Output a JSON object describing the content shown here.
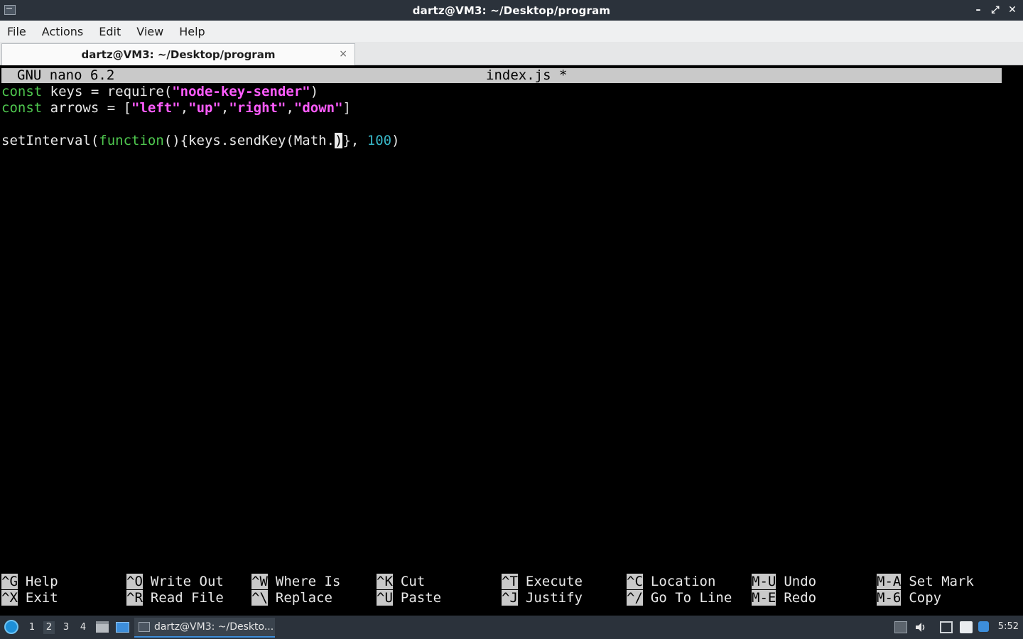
{
  "window": {
    "title": "dartz@VM3: ~/Desktop/program",
    "controls": {
      "minimize": "–",
      "maximize": "⤢",
      "close": "✕"
    }
  },
  "menu": {
    "items": [
      "File",
      "Actions",
      "Edit",
      "View",
      "Help"
    ]
  },
  "tab": {
    "label": "dartz@VM3: ~/Desktop/program",
    "close": "×"
  },
  "nano": {
    "version": "GNU nano 6.2",
    "filename": "index.js *",
    "code": {
      "line1": {
        "kw": "const",
        "rest1": " keys = require(",
        "str": "\"node-key-sender\"",
        "rest2": ")"
      },
      "line2": {
        "kw": "const",
        "rest1": " arrows = [",
        "s1": "\"left\"",
        "c1": ",",
        "s2": "\"up\"",
        "c2": ",",
        "s3": "\"right\"",
        "c3": ",",
        "s4": "\"down\"",
        "rest2": "]"
      },
      "line4": {
        "a": "setInterval(",
        "fn": "function",
        "b": "(){keys.sendKey(Math.",
        "cursor": ")",
        "c": "}, ",
        "num": "100",
        "d": ")"
      }
    },
    "shortcuts": [
      {
        "key": "^G",
        "label": "Help"
      },
      {
        "key": "^X",
        "label": "Exit"
      },
      {
        "key": "^O",
        "label": "Write Out"
      },
      {
        "key": "^R",
        "label": "Read File"
      },
      {
        "key": "^W",
        "label": "Where Is"
      },
      {
        "key": "^\\",
        "label": "Replace"
      },
      {
        "key": "^K",
        "label": "Cut"
      },
      {
        "key": "^U",
        "label": "Paste"
      },
      {
        "key": "^T",
        "label": "Execute"
      },
      {
        "key": "^J",
        "label": "Justify"
      },
      {
        "key": "^C",
        "label": "Location"
      },
      {
        "key": "^/",
        "label": "Go To Line"
      },
      {
        "key": "M-U",
        "label": "Undo"
      },
      {
        "key": "M-E",
        "label": "Redo"
      },
      {
        "key": "M-A",
        "label": "Set Mark"
      },
      {
        "key": "M-6",
        "label": "Copy"
      }
    ]
  },
  "taskbar": {
    "workspaces": [
      "1",
      "2",
      "3",
      "4"
    ],
    "active_workspace": "2",
    "task_label": "dartz@VM3: ~/Deskto...",
    "clock": "5:52"
  }
}
